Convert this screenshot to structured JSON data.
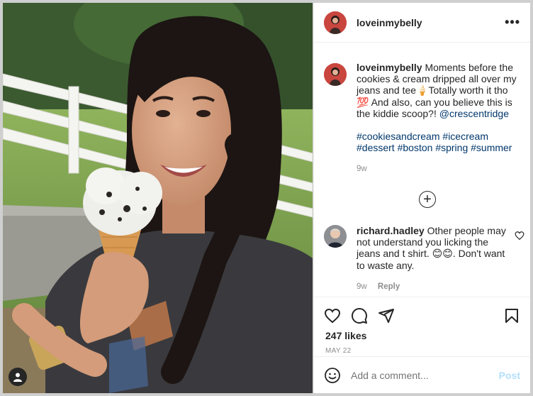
{
  "colors": {
    "text": "#262626",
    "secondary": "#8e8e8e",
    "link": "#00376b",
    "post_disabled": "#b2dffc",
    "divider": "#efefef",
    "avatar_brand": "#c9463f"
  },
  "post": {
    "author": "loveinmybelly",
    "more_icon": "more-horizontal-icon",
    "caption": {
      "username": "loveinmybelly",
      "text_1": "Moments before the cookies & cream dripped all over my jeans and tee",
      "emoji_1": "🍦",
      "text_2": "Totally worth it tho",
      "emoji_2": "💯",
      "text_3": "And also, can you believe this is the kiddie scoop?!",
      "mention": "@crescentridge",
      "hashtags": [
        "#cookiesandcream",
        "#icecream",
        "#dessert",
        "#boston",
        "#spring",
        "#summer"
      ],
      "age": "9w"
    },
    "load_more_icon": "plus-circle-icon",
    "comments": [
      {
        "username": "richard.hadley",
        "text": "Other people may not understand you licking the jeans and t shirt.",
        "emoji": "😊😊",
        "text_after": ". Don't want to waste any.",
        "age": "9w",
        "reply_label": "Reply"
      }
    ],
    "actions": {
      "like_icon": "heart-icon",
      "comment_icon": "comment-icon",
      "share_icon": "paper-plane-icon",
      "save_icon": "bookmark-icon"
    },
    "likes": "247 likes",
    "date": "MAY 22"
  },
  "composer": {
    "emoji_icon": "smiley-icon",
    "placeholder": "Add a comment...",
    "post_label": "Post"
  }
}
